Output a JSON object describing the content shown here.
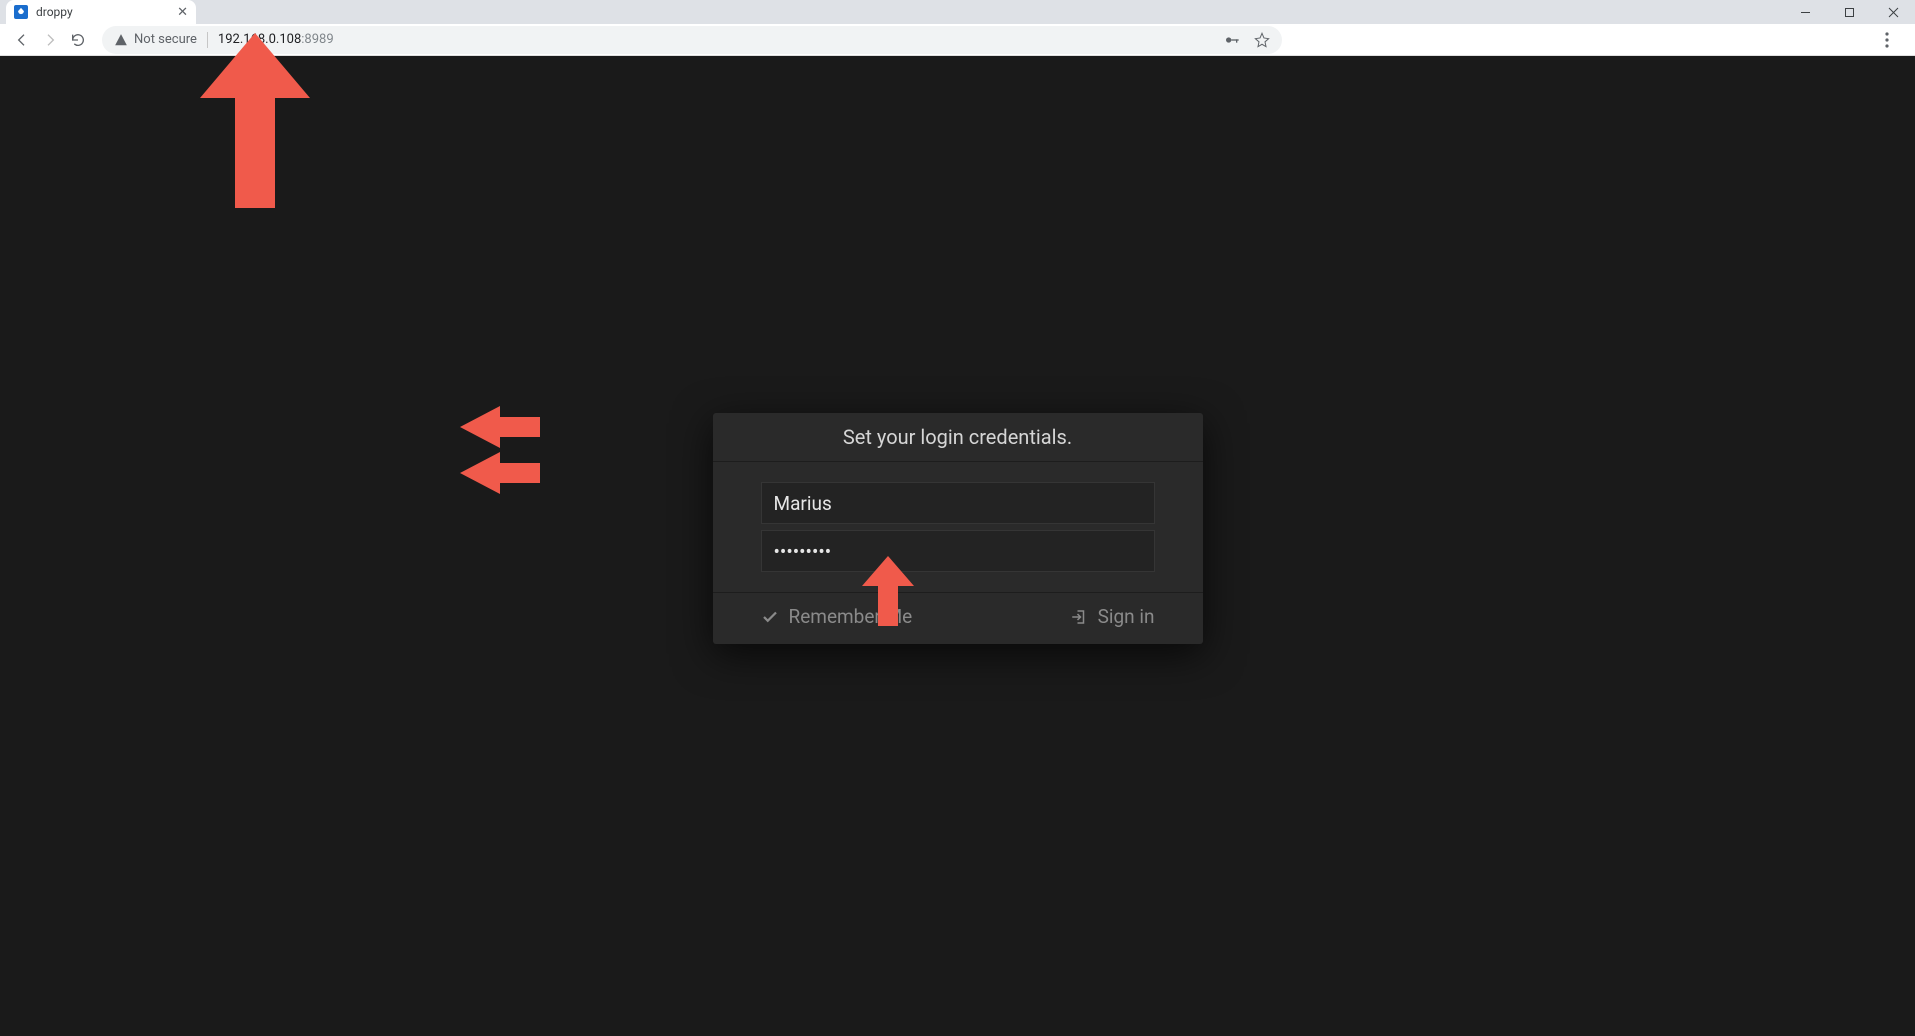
{
  "browser": {
    "tab_title": "droppy",
    "not_secure_label": "Not secure",
    "url_main": "192.168.0.108",
    "url_port": ":8989"
  },
  "login": {
    "heading": "Set your login credentials.",
    "username_value": "Marius",
    "password_value": "•••••••••",
    "remember_label": "Remember Me",
    "signin_label": "Sign in"
  },
  "colors": {
    "page_bg": "#1a1a1a",
    "panel_bg": "#2a2a2a",
    "arrow": "#f05a4b"
  }
}
